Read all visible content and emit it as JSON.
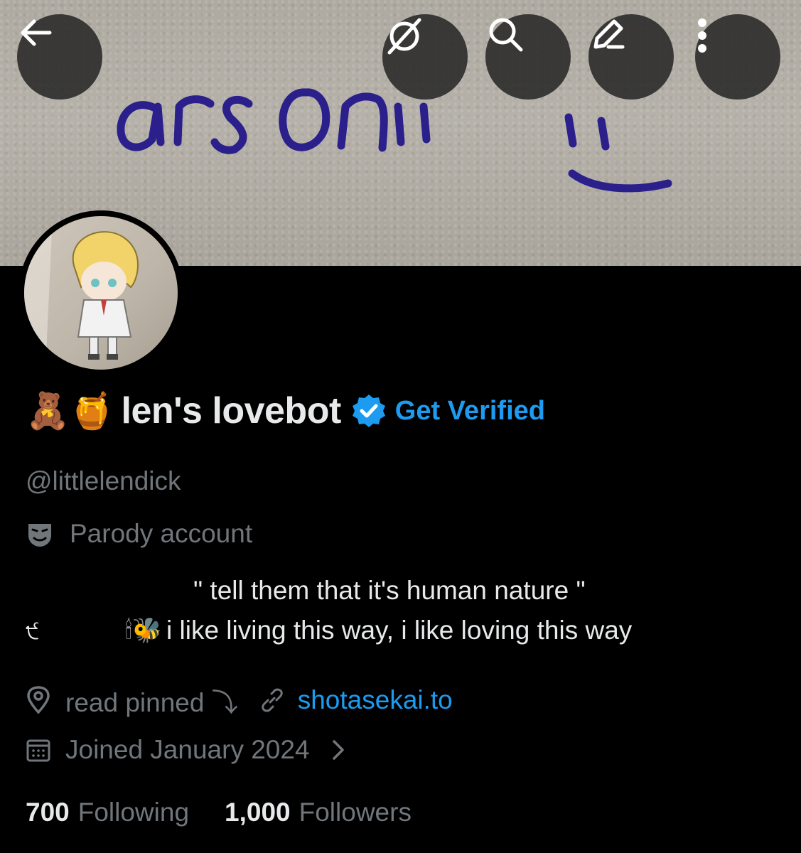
{
  "header": {
    "banner_text": "arson!!",
    "back_icon": "arrow-left-icon",
    "grok_icon": "grok-icon",
    "search_icon": "search-icon",
    "edit_icon": "pencil-icon",
    "more_icon": "more-vertical-icon"
  },
  "profile": {
    "name_emojis": "🧸🍯",
    "display_name": "len's lovebot",
    "verified_icon": "verified-badge-icon",
    "get_verified_label": "Get Verified",
    "handle": "@littlelendick",
    "parody_label": "Parody account",
    "bio_line1": "\" tell them that it's human nature \"",
    "bio_line2_prefix": "੯",
    "bio_line2_emojis": "🕯🐝",
    "bio_line2": "i like living this way, i like loving this way",
    "location": "read pinned ⤵",
    "website": "shotasekai.to",
    "joined": "Joined January 2024",
    "following_count": "700",
    "following_label": "Following",
    "followers_count": "1,000",
    "followers_label": "Followers"
  },
  "colors": {
    "accent": "#1d9bf0",
    "muted": "#71767b",
    "text": "#e7e9ea",
    "background": "#000000"
  }
}
